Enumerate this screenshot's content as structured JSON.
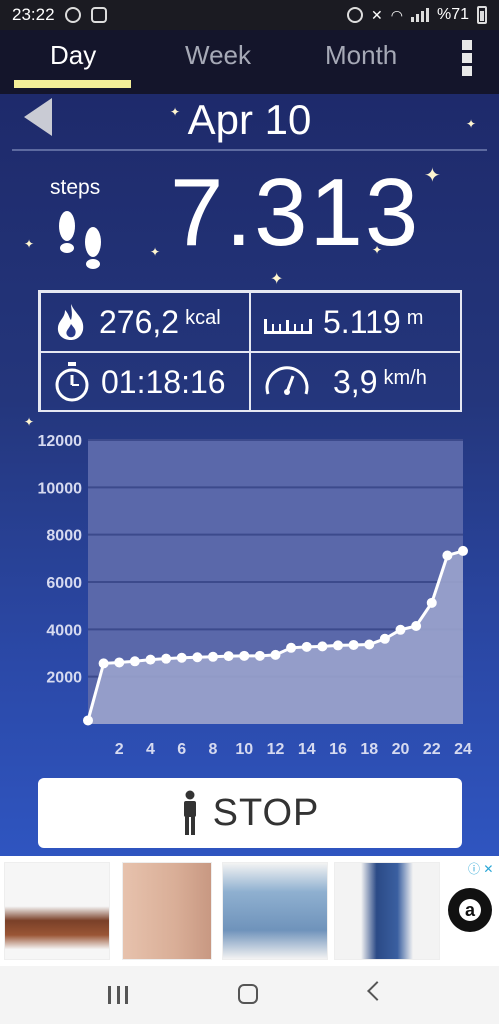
{
  "status_bar": {
    "time": "23:22",
    "battery_text": "%71"
  },
  "tabs": [
    {
      "label": "Day",
      "active": true
    },
    {
      "label": "Week",
      "active": false
    },
    {
      "label": "Month",
      "active": false
    }
  ],
  "header": {
    "date": "Apr 10"
  },
  "steps": {
    "label": "steps",
    "value": "7.313"
  },
  "stats": {
    "calories": {
      "value": "276,2",
      "unit": "kcal",
      "icon": "flame-icon"
    },
    "distance": {
      "value": "5.119",
      "unit": "m",
      "icon": "ruler-icon"
    },
    "duration": {
      "value": "01:18:16",
      "icon": "stopwatch-icon"
    },
    "speed": {
      "value": "3,9",
      "unit": "km/h",
      "icon": "speedometer-icon"
    }
  },
  "chart_data": {
    "type": "line",
    "x": [
      0,
      1,
      2,
      3,
      4,
      5,
      6,
      7,
      8,
      9,
      10,
      11,
      12,
      13,
      14,
      15,
      16,
      17,
      18,
      19,
      20,
      21,
      22,
      23,
      24
    ],
    "values": [
      150,
      2560,
      2600,
      2650,
      2720,
      2760,
      2800,
      2820,
      2840,
      2870,
      2880,
      2880,
      2920,
      3220,
      3260,
      3280,
      3320,
      3340,
      3360,
      3600,
      3980,
      4140,
      5120,
      7120,
      7313
    ],
    "xticks": [
      "2",
      "4",
      "6",
      "8",
      "10",
      "12",
      "14",
      "16",
      "18",
      "20",
      "22",
      "24"
    ],
    "yticks": [
      "2000",
      "4000",
      "6000",
      "8000",
      "10000",
      "12000"
    ],
    "xlim": [
      0,
      24
    ],
    "ylim": [
      0,
      12000
    ],
    "grid": true,
    "colors": {
      "line": "#ffffff",
      "fill": "#9aa3cc",
      "plot_bg": "#5a68aa"
    }
  },
  "stop_button": {
    "label": "STOP"
  },
  "colors": {
    "accent": "#f3ee98",
    "tab_bg": "#14152b"
  }
}
